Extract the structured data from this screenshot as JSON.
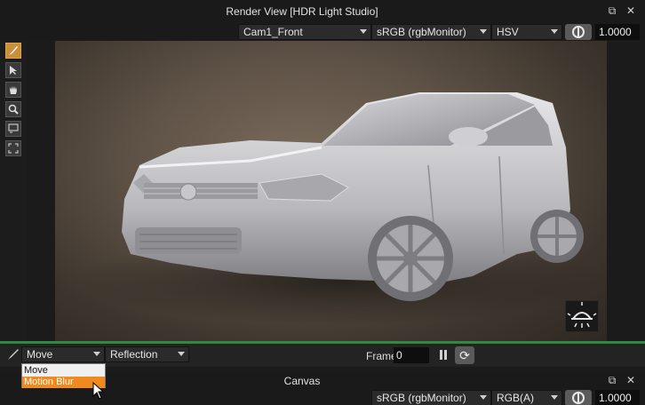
{
  "render_view": {
    "title": "Render View [HDR Light Studio]",
    "camera": "Cam1_Front",
    "color_space": "sRGB (rgbMonitor)",
    "color_mode": "HSV",
    "exposure": "1.0000",
    "left_tools": [
      "paint-brush-icon",
      "select-arrow-icon",
      "hand-pan-icon",
      "zoom-icon",
      "region-select-icon",
      "fit-view-icon"
    ]
  },
  "bottom": {
    "mode_dropdown": "Move",
    "reflection_dropdown": "Reflection",
    "frame_label": "Frame",
    "frame_value": "0",
    "mode_menu": {
      "items": [
        "Move",
        "Motion Blur"
      ],
      "selected": "Motion Blur"
    }
  },
  "canvas": {
    "title": "Canvas",
    "color_space": "sRGB (rgbMonitor)",
    "channels": "RGB(A)",
    "exposure": "1.0000"
  },
  "colors": {
    "accent_orange": "#f08a1c",
    "active_tool": "#c8903a",
    "status_green": "#2f8a3f"
  }
}
